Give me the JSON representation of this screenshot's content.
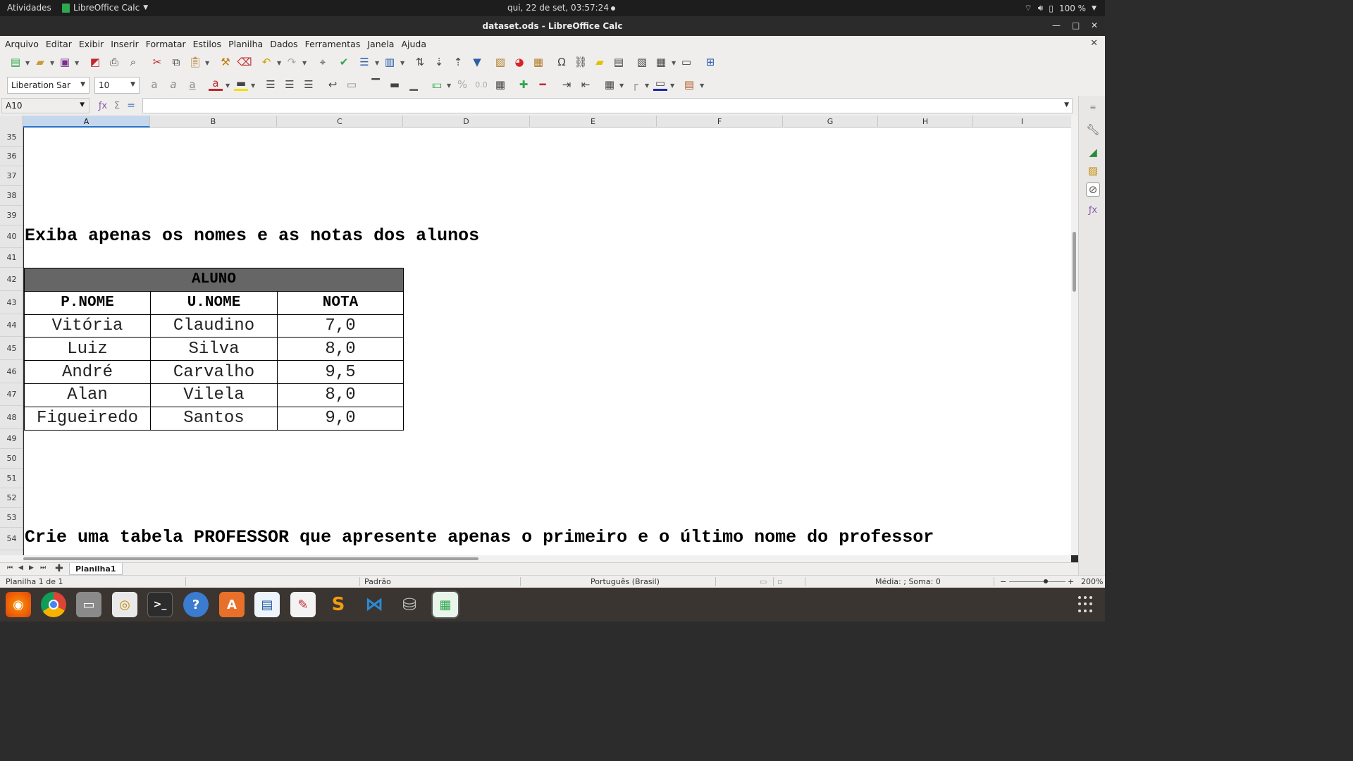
{
  "topbar": {
    "activities": "Atividades",
    "app_name": "LibreOffice Calc",
    "clock": "qui, 22 de set, 03:57:24",
    "battery": "100 %"
  },
  "window": {
    "title": "dataset.ods - LibreOffice Calc"
  },
  "menu": [
    "Arquivo",
    "Editar",
    "Exibir",
    "Inserir",
    "Formatar",
    "Estilos",
    "Planilha",
    "Dados",
    "Ferramentas",
    "Janela",
    "Ajuda"
  ],
  "toolbar": {
    "font_name": "Liberation Sar",
    "font_size": "10"
  },
  "formula_bar": {
    "cell_ref": "A10",
    "content": ""
  },
  "columns": [
    "A",
    "B",
    "C",
    "D",
    "E",
    "F",
    "G",
    "H",
    "I"
  ],
  "rows": [
    "35",
    "36",
    "37",
    "38",
    "39",
    "40",
    "41",
    "42",
    "43",
    "44",
    "45",
    "46",
    "47",
    "48",
    "49",
    "50",
    "51",
    "52",
    "53",
    "54"
  ],
  "sheet": {
    "heading1": "Exiba apenas os nomes e as notas dos alunos",
    "table": {
      "group_header": "ALUNO",
      "headers": [
        "P.NOME",
        "U.NOME",
        "NOTA"
      ],
      "rows": [
        [
          "Vitória",
          "Claudino",
          "7,0"
        ],
        [
          "Luiz",
          "Silva",
          "8,0"
        ],
        [
          "André",
          "Carvalho",
          "9,5"
        ],
        [
          "Alan",
          "Vilela",
          "8,0"
        ],
        [
          "Figueiredo",
          "Santos",
          "9,0"
        ]
      ]
    },
    "heading2": "Crie uma tabela PROFESSOR que apresente apenas o primeiro e o último nome do professor"
  },
  "tabs": {
    "sheet_name": "Planilha1"
  },
  "status": {
    "sheet_info": "Planilha 1 de 1",
    "page_style": "Padrão",
    "language": "Português (Brasil)",
    "summary": "Média: ; Soma: 0",
    "zoom": "200%"
  }
}
